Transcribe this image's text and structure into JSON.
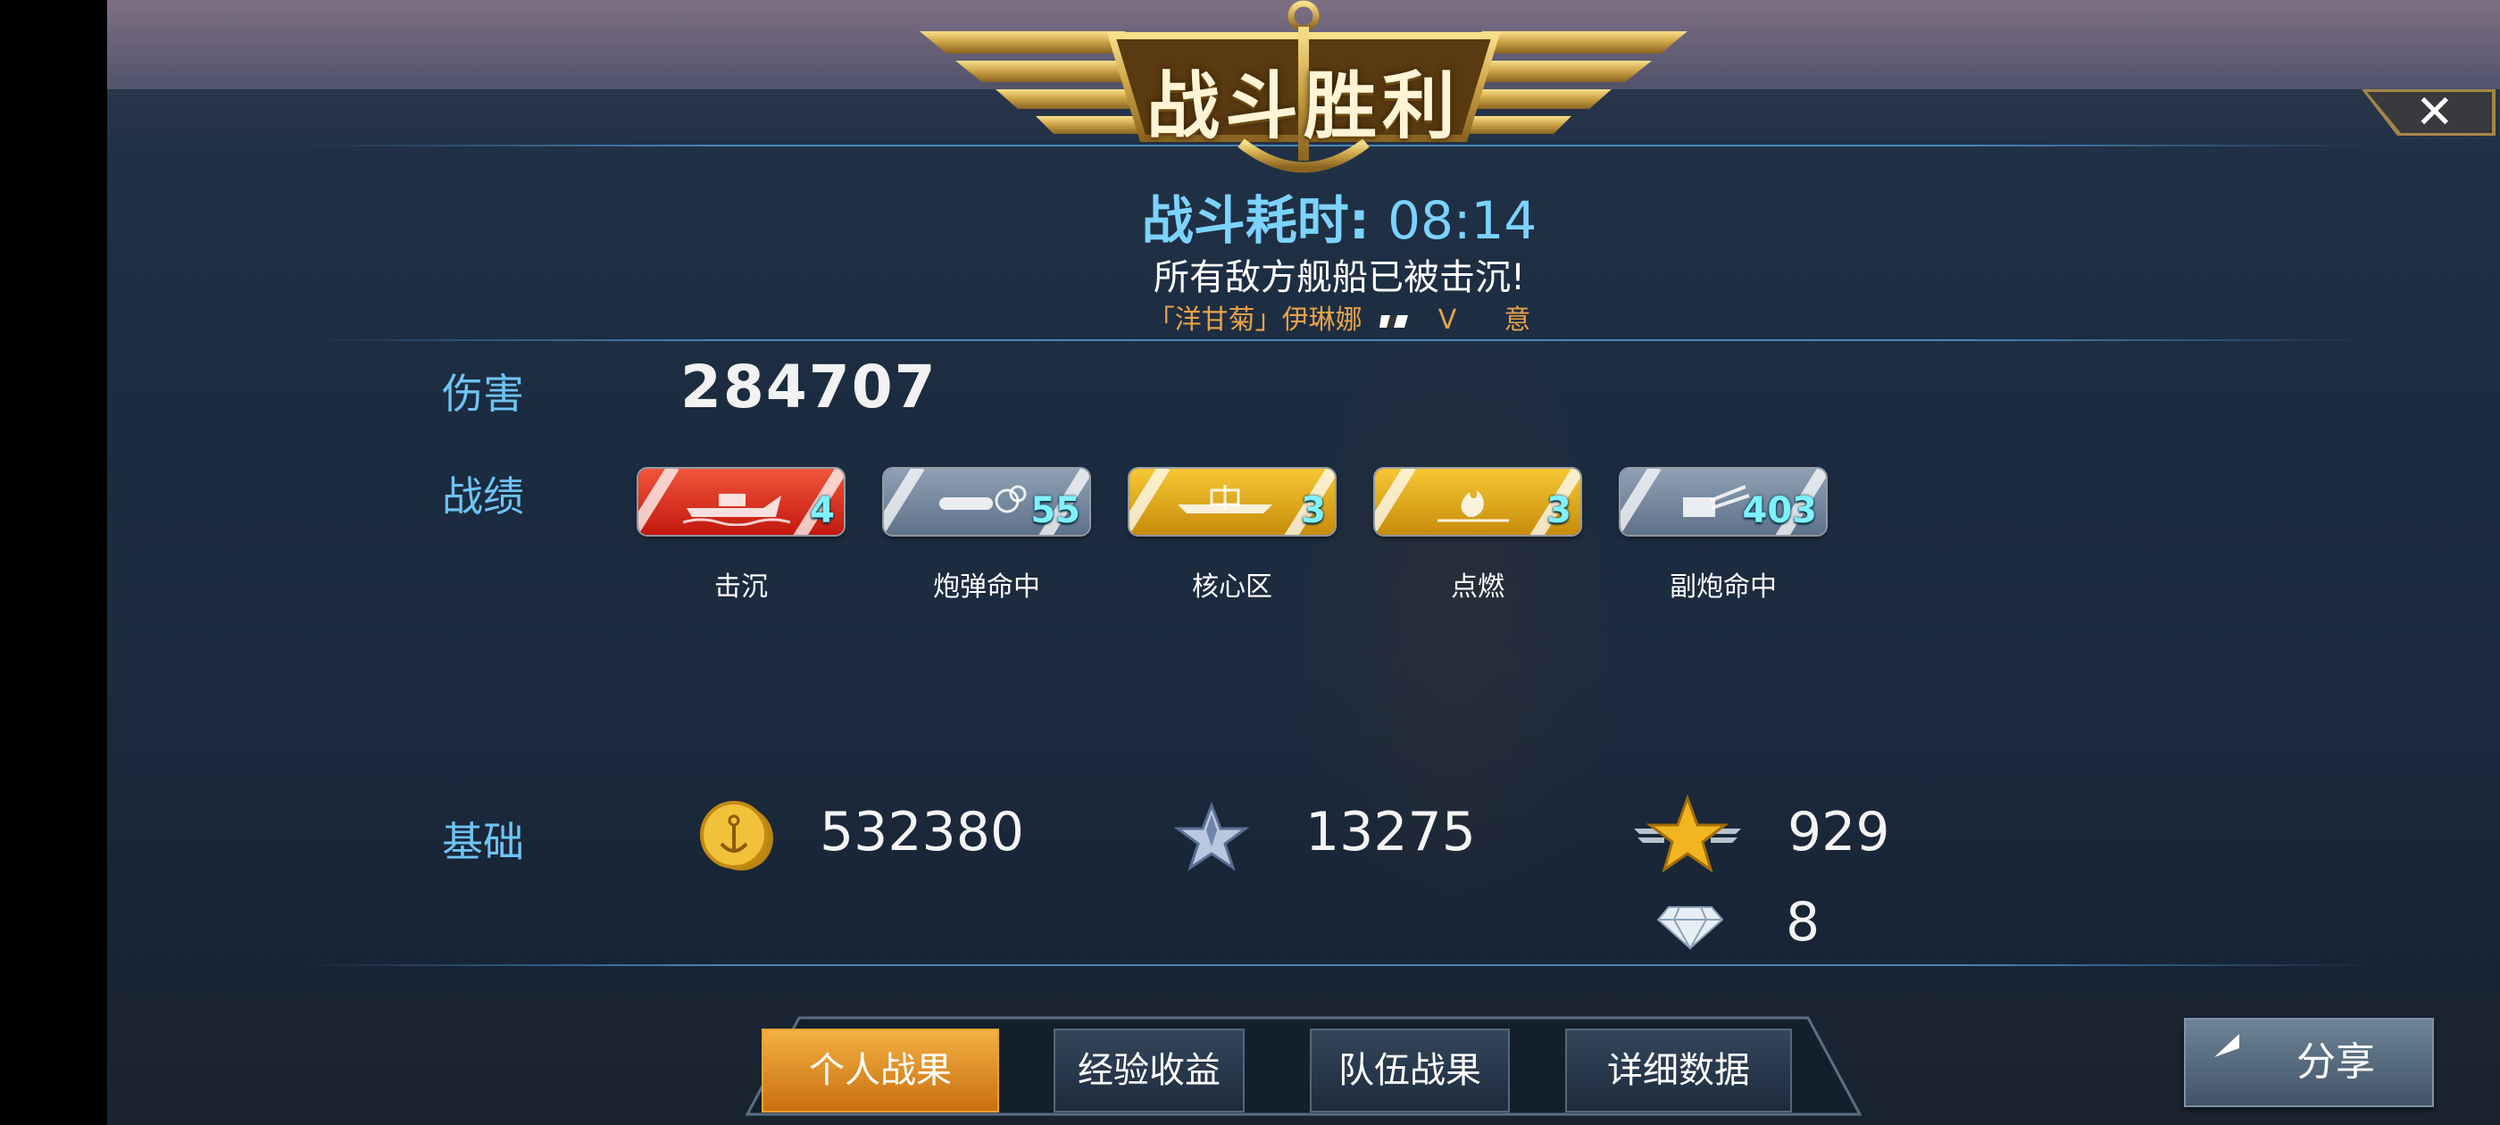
{
  "header": {
    "title": "战斗胜利",
    "battle_time_label": "战斗耗时:",
    "battle_time_value": "08:14",
    "result_message": "所有敌方舰船已被击沉!",
    "ship_name": "「洋甘菊」伊琳娜",
    "ship_tier": "V",
    "ship_nation": "意"
  },
  "close_icon": "close-icon",
  "damage": {
    "label": "伤害",
    "value": "284707"
  },
  "achievements": {
    "label": "战绩",
    "items": [
      {
        "name": "击沉",
        "count": "4",
        "icon": "sinking-ship-icon",
        "color": "#e03a22"
      },
      {
        "name": "炮弹命中",
        "count": "55",
        "icon": "shell-hit-icon",
        "color": "#7487a0"
      },
      {
        "name": "核心区",
        "count": "3",
        "icon": "citadel-icon",
        "color": "#e5aa18"
      },
      {
        "name": "点燃",
        "count": "3",
        "icon": "fire-icon",
        "color": "#e5aa18"
      },
      {
        "name": "副炮命中",
        "count": "403",
        "icon": "secondary-gun-icon",
        "color": "#7487a0"
      }
    ]
  },
  "base": {
    "label": "基础",
    "coins": "532380",
    "ship_exp": "13275",
    "captain_exp": "929",
    "diamonds": "8"
  },
  "tabs": [
    {
      "label": "个人战果",
      "active": true
    },
    {
      "label": "经验收益",
      "active": false
    },
    {
      "label": "队伍战果",
      "active": false
    },
    {
      "label": "详细数据",
      "active": false
    }
  ],
  "share": {
    "label": "分享",
    "icon": "share-arrow-icon"
  }
}
